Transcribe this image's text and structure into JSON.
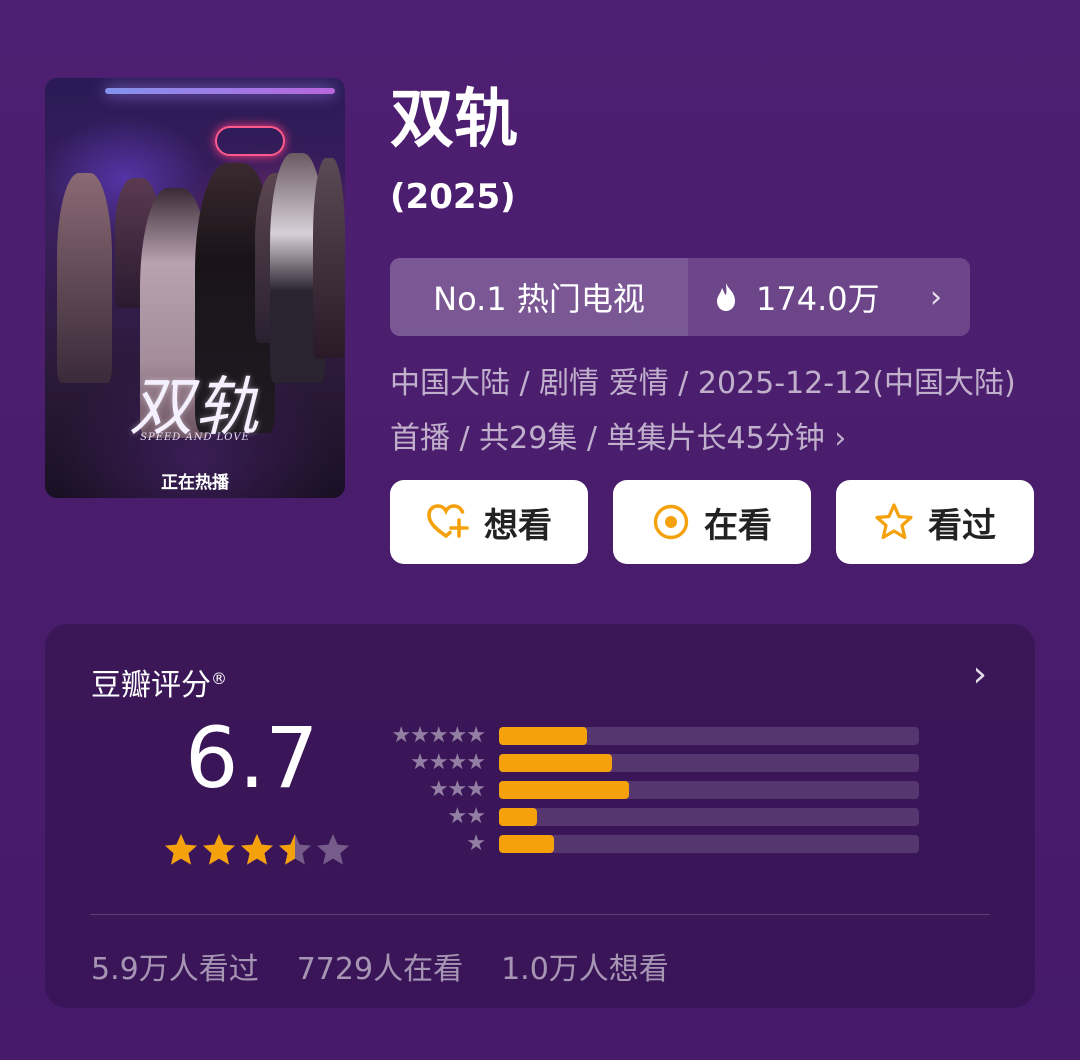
{
  "poster": {
    "title_art": "双轨",
    "subtitle_art": "SPEED AND LOVE",
    "airing_label": "正在热播"
  },
  "title": "双轨",
  "year": "(2025)",
  "rank": {
    "label": "No.1 热门电视",
    "heat": "174.0万"
  },
  "meta_text": "中国大陆 / 剧情 爱情 / 2025-12-12(中国大陆)首播 / 共29集 / 单集片长45分钟 ›",
  "actions": {
    "want": "想看",
    "watching": "在看",
    "watched": "看过"
  },
  "rating": {
    "title": "豆瓣评分",
    "score": "6.7",
    "stars_value": 3.5,
    "distribution": [
      {
        "stars": 5,
        "fraction": 0.21
      },
      {
        "stars": 4,
        "fraction": 0.27
      },
      {
        "stars": 3,
        "fraction": 0.31
      },
      {
        "stars": 2,
        "fraction": 0.09
      },
      {
        "stars": 1,
        "fraction": 0.13
      }
    ],
    "stats": {
      "watched": "5.9万人看过",
      "watching": "7729人在看",
      "want": "1.0万人想看"
    }
  },
  "colors": {
    "accent": "#f5a10c",
    "background": "#4e1f72"
  }
}
